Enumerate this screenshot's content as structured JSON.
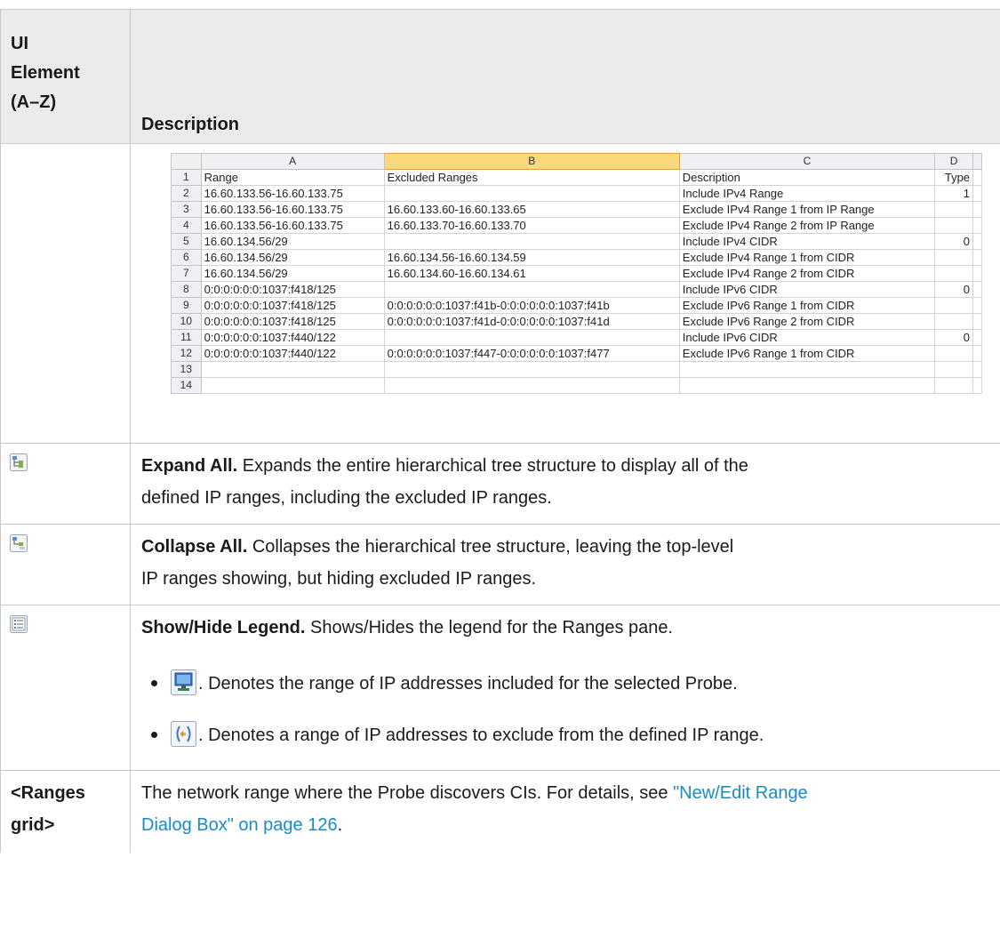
{
  "header": {
    "col1": [
      "UI",
      "Element",
      "(A–Z)"
    ],
    "col2": "Description"
  },
  "spreadsheet": {
    "col_letters": [
      "A",
      "B",
      "C",
      "D"
    ],
    "rows": [
      {
        "n": "1",
        "a": "Range",
        "b": "Excluded Ranges",
        "c": "Description",
        "d": "Type"
      },
      {
        "n": "2",
        "a": "16.60.133.56-16.60.133.75",
        "b": "",
        "c": "Include IPv4 Range",
        "d": "1"
      },
      {
        "n": "3",
        "a": "16.60.133.56-16.60.133.75",
        "b": "16.60.133.60-16.60.133.65",
        "c": "Exclude IPv4 Range 1 from IP Range",
        "d": ""
      },
      {
        "n": "4",
        "a": "16.60.133.56-16.60.133.75",
        "b": "16.60.133.70-16.60.133.70",
        "c": "Exclude IPv4 Range 2 from IP Range",
        "d": ""
      },
      {
        "n": "5",
        "a": "16.60.134.56/29",
        "b": "",
        "c": "Include IPv4 CIDR",
        "d": "0"
      },
      {
        "n": "6",
        "a": "16.60.134.56/29",
        "b": "16.60.134.56-16.60.134.59",
        "c": "Exclude IPv4 Range 1 from CIDR",
        "d": ""
      },
      {
        "n": "7",
        "a": "16.60.134.56/29",
        "b": "16.60.134.60-16.60.134.61",
        "c": "Exclude IPv4 Range 2 from CIDR",
        "d": ""
      },
      {
        "n": "8",
        "a": "0:0:0:0:0:0:1037:f418/125",
        "b": "",
        "c": "Include IPv6 CIDR",
        "d": "0"
      },
      {
        "n": "9",
        "a": "0:0:0:0:0:0:1037:f418/125",
        "b": "0:0:0:0:0:0:1037:f41b-0:0:0:0:0:0:1037:f41b",
        "c": "Exclude IPv6 Range 1 from CIDR",
        "d": ""
      },
      {
        "n": "10",
        "a": "0:0:0:0:0:0:1037:f418/125",
        "b": "0:0:0:0:0:0:1037:f41d-0:0:0:0:0:0:1037:f41d",
        "c": "Exclude IPv6 Range 2 from CIDR",
        "d": ""
      },
      {
        "n": "11",
        "a": "0:0:0:0:0:0:1037:f440/122",
        "b": "",
        "c": "Include IPv6 CIDR",
        "d": "0"
      },
      {
        "n": "12",
        "a": "0:0:0:0:0:0:1037:f440/122",
        "b": "0:0:0:0:0:0:1037:f447-0:0:0:0:0:0:1037:f477",
        "c": "Exclude IPv6 Range 1 from CIDR",
        "d": ""
      },
      {
        "n": "13",
        "a": "",
        "b": "",
        "c": "",
        "d": ""
      },
      {
        "n": "14",
        "a": "",
        "b": "",
        "c": "",
        "d": ""
      }
    ]
  },
  "expand_all": {
    "icon": "expand-all-icon",
    "title": "Expand All.",
    "line1": " Expands the entire hierarchical tree structure to display all of the",
    "line2": "defined IP ranges, including the excluded IP ranges."
  },
  "collapse_all": {
    "icon": "collapse-all-icon",
    "title": "Collapse All.",
    "line1": " Collapses the hierarchical tree structure, leaving the top-level",
    "line2": "IP ranges showing, but hiding excluded IP ranges."
  },
  "legend": {
    "icon": "legend-icon",
    "title": "Show/Hide Legend.",
    "text": " Shows/Hides the legend for the Ranges pane.",
    "bullets": [
      {
        "icon": "monitor-icon",
        "text": ". Denotes the range of IP addresses included for the selected Probe."
      },
      {
        "icon": "exclude-range-icon",
        "text": ". Denotes a range of IP addresses to exclude from the defined IP range."
      }
    ]
  },
  "ranges_grid": {
    "label_line1": "<Ranges",
    "label_line2": "grid>",
    "text1": "The network range where the Probe discovers CIs. For details, see ",
    "link1": "\"New/Edit Range",
    "link2": "Dialog Box\" on page 126",
    "text2": "."
  },
  "colors": {
    "link": "#1a8bc7",
    "header_bg": "#ebebeb",
    "selected_col": "#f9d97c"
  }
}
